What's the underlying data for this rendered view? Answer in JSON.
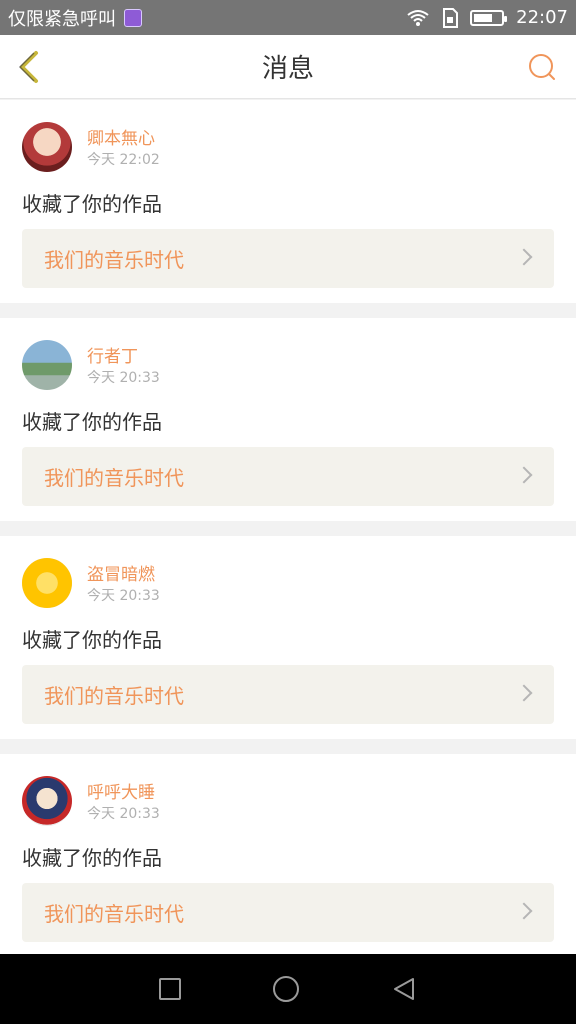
{
  "status_bar": {
    "carrier": "仅限紧急呼叫",
    "time": "22:07",
    "battery_level": 0.7,
    "icons": [
      "app-badge-icon",
      "wifi-icon",
      "sim-icon",
      "battery-icon"
    ]
  },
  "nav": {
    "title": "消息",
    "back_icon": "chevron-left-icon",
    "search_icon": "search-icon",
    "accent": "#f0955a",
    "back_color": "#c7b73b"
  },
  "messages": [
    {
      "user": "卿本無心",
      "time": "今天 22:02",
      "action": "收藏了你的作品",
      "work": "我们的音乐时代",
      "avatar": "anime-girl-avatar"
    },
    {
      "user": "行者丁",
      "time": "今天 20:33",
      "action": "收藏了你的作品",
      "work": "我们的音乐时代",
      "avatar": "outdoor-photo-avatar"
    },
    {
      "user": "盗冒暗燃",
      "time": "今天 20:33",
      "action": "收藏了你的作品",
      "work": "我们的音乐时代",
      "avatar": "sunflower-avatar"
    },
    {
      "user": "呼呼大睡",
      "time": "今天 20:33",
      "action": "收藏了你的作品",
      "work": "我们的音乐时代",
      "avatar": "anime-boy-avatar"
    }
  ],
  "system_nav": [
    "recent-apps-icon",
    "home-icon",
    "back-icon"
  ]
}
